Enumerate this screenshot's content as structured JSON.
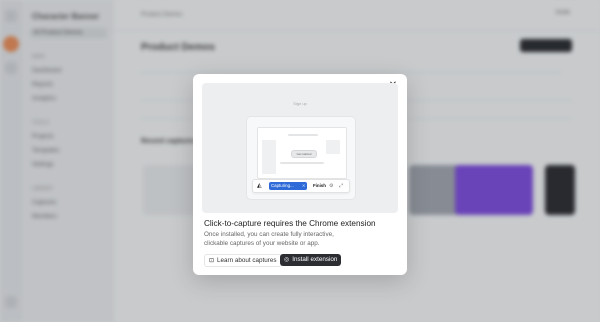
{
  "background": {
    "sidebar_title": "Character Banner",
    "workspace": "All Product Demos",
    "sections": [
      "MAIN",
      "TOOLS",
      "LIBRARY"
    ],
    "items": [
      "Dashboard",
      "Reports",
      "Analytics",
      "Projects",
      "Templates",
      "Settings",
      "Captures",
      "Members"
    ],
    "breadcrumb": "Product Demos",
    "top_button": "Invite",
    "page_title": "Product Demos",
    "section_label": "Recent captures"
  },
  "modal": {
    "close_icon": "close-icon",
    "preview": {
      "tiny_label": "Sign up",
      "pill_label": "Get started",
      "capturing_label": "Capturing...",
      "finish_label": "Finish",
      "logo_icon": "app-logo-icon",
      "settings_icon": "gear-icon",
      "expand_icon": "expand-icon"
    },
    "heading": "Click-to-capture requires the Chrome extension",
    "description": "Once installed, you can create fully interactive, clickable captures of your website or app.",
    "learn_button": "Learn about captures",
    "learn_icon": "book-icon",
    "install_button": "Install extension",
    "install_icon": "chrome-icon"
  }
}
